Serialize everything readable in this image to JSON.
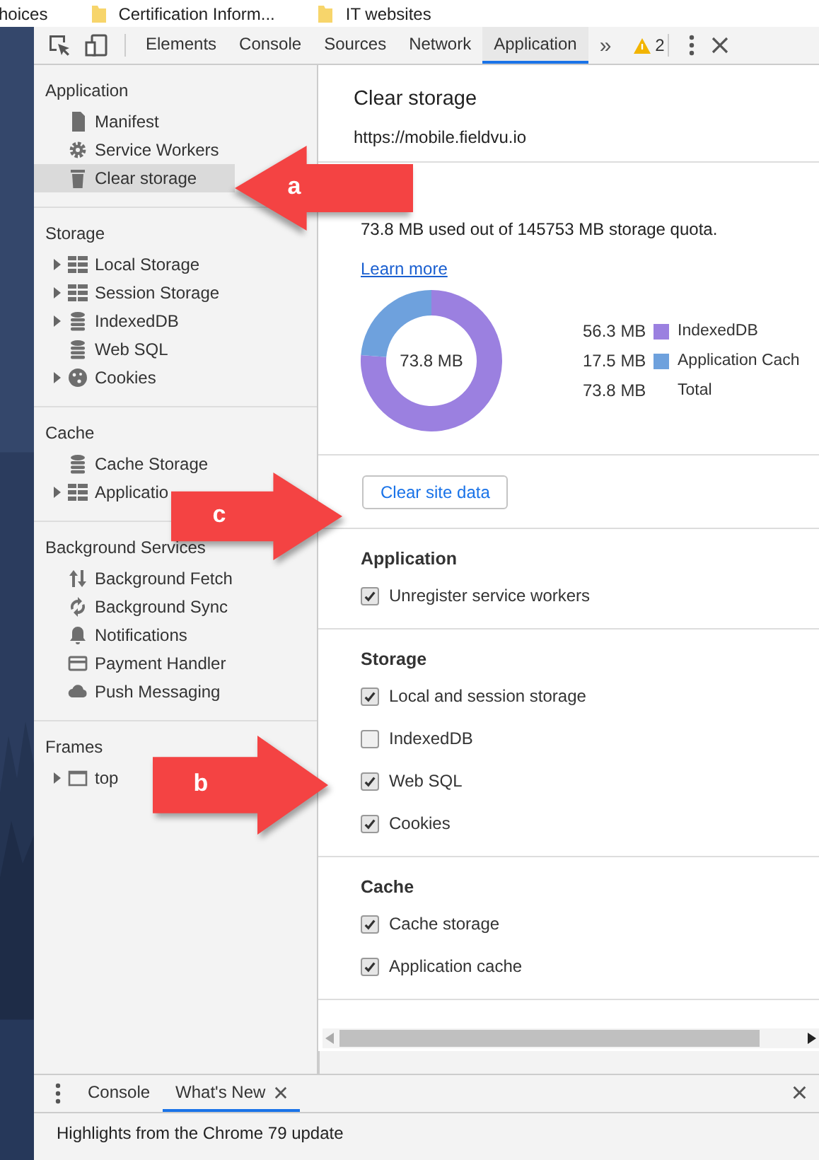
{
  "bookmarks": [
    {
      "label": "hoices",
      "folder": false
    },
    {
      "label": "Certification Inform...",
      "folder": true
    },
    {
      "label": "IT websites",
      "folder": true
    }
  ],
  "toolbar": {
    "tabs": [
      {
        "label": "Elements",
        "selected": false
      },
      {
        "label": "Console",
        "selected": false
      },
      {
        "label": "Sources",
        "selected": false
      },
      {
        "label": "Network",
        "selected": false
      },
      {
        "label": "Application",
        "selected": true
      }
    ],
    "more": "»",
    "warnings": "2"
  },
  "sidebar": {
    "sections": [
      {
        "title": "Application",
        "items": [
          {
            "label": "Manifest",
            "kind": "file",
            "expandable": false,
            "selected": false
          },
          {
            "label": "Service Workers",
            "kind": "gear",
            "expandable": false,
            "selected": false
          },
          {
            "label": "Clear storage",
            "kind": "trash",
            "expandable": false,
            "selected": true
          }
        ]
      },
      {
        "title": "Storage",
        "items": [
          {
            "label": "Local Storage",
            "kind": "grid",
            "expandable": true,
            "selected": false
          },
          {
            "label": "Session Storage",
            "kind": "grid",
            "expandable": true,
            "selected": false
          },
          {
            "label": "IndexedDB",
            "kind": "db",
            "expandable": true,
            "selected": false
          },
          {
            "label": "Web SQL",
            "kind": "db",
            "expandable": false,
            "selected": false
          },
          {
            "label": "Cookies",
            "kind": "cookie",
            "expandable": true,
            "selected": false
          }
        ]
      },
      {
        "title": "Cache",
        "items": [
          {
            "label": "Cache Storage",
            "kind": "db",
            "expandable": false,
            "selected": false
          },
          {
            "label": "Applicatio",
            "kind": "grid",
            "expandable": true,
            "selected": false
          }
        ]
      },
      {
        "title": "Background Services",
        "items": [
          {
            "label": "Background Fetch",
            "kind": "updown",
            "expandable": false,
            "selected": false
          },
          {
            "label": "Background Sync",
            "kind": "sync",
            "expandable": false,
            "selected": false
          },
          {
            "label": "Notifications",
            "kind": "bell",
            "expandable": false,
            "selected": false
          },
          {
            "label": "Payment Handler",
            "kind": "card",
            "expandable": false,
            "selected": false
          },
          {
            "label": "Push Messaging",
            "kind": "cloud",
            "expandable": false,
            "selected": false
          }
        ]
      },
      {
        "title": "Frames",
        "items": [
          {
            "label": "top",
            "kind": "frame",
            "expandable": true,
            "selected": false
          }
        ]
      }
    ]
  },
  "main": {
    "title": "Clear storage",
    "origin": "https://mobile.fieldvu.io",
    "usage": "73.8 MB used out of 145753 MB storage quota.",
    "learn_more": "Learn more",
    "chart_data": {
      "type": "donut",
      "categories": [
        "IndexedDB",
        "Application Cach"
      ],
      "values": [
        76.29,
        23.71
      ]
    },
    "donut_label": "73.8 MB",
    "legend": [
      {
        "amount": "56.3 MB",
        "color": "#9b80e0"
      },
      {
        "amount": "17.5 MB",
        "color": "#6ea1dd"
      }
    ],
    "total": {
      "amount": "73.8 MB",
      "label": "Total"
    },
    "button": "Clear site data",
    "groups": [
      {
        "title": "Application",
        "options": [
          {
            "label": "Unregister service workers",
            "checked": true
          }
        ]
      },
      {
        "title": "Storage",
        "options": [
          {
            "label": "Local and session storage",
            "checked": true
          },
          {
            "label": "IndexedDB",
            "checked": false
          },
          {
            "label": "Web SQL",
            "checked": true
          },
          {
            "label": "Cookies",
            "checked": true
          }
        ]
      },
      {
        "title": "Cache",
        "options": [
          {
            "label": "Cache storage",
            "checked": true
          },
          {
            "label": "Application cache",
            "checked": true
          }
        ]
      }
    ]
  },
  "drawer": {
    "tabs": [
      {
        "label": "Console",
        "selected": false,
        "closable": false
      },
      {
        "label": "What's New",
        "selected": true,
        "closable": true
      }
    ],
    "close": "×",
    "content": "Highlights from the Chrome 79 update"
  },
  "annotations": [
    {
      "label": "a",
      "kind": "left"
    },
    {
      "label": "c",
      "kind": "right"
    },
    {
      "label": "b",
      "kind": "right"
    }
  ]
}
